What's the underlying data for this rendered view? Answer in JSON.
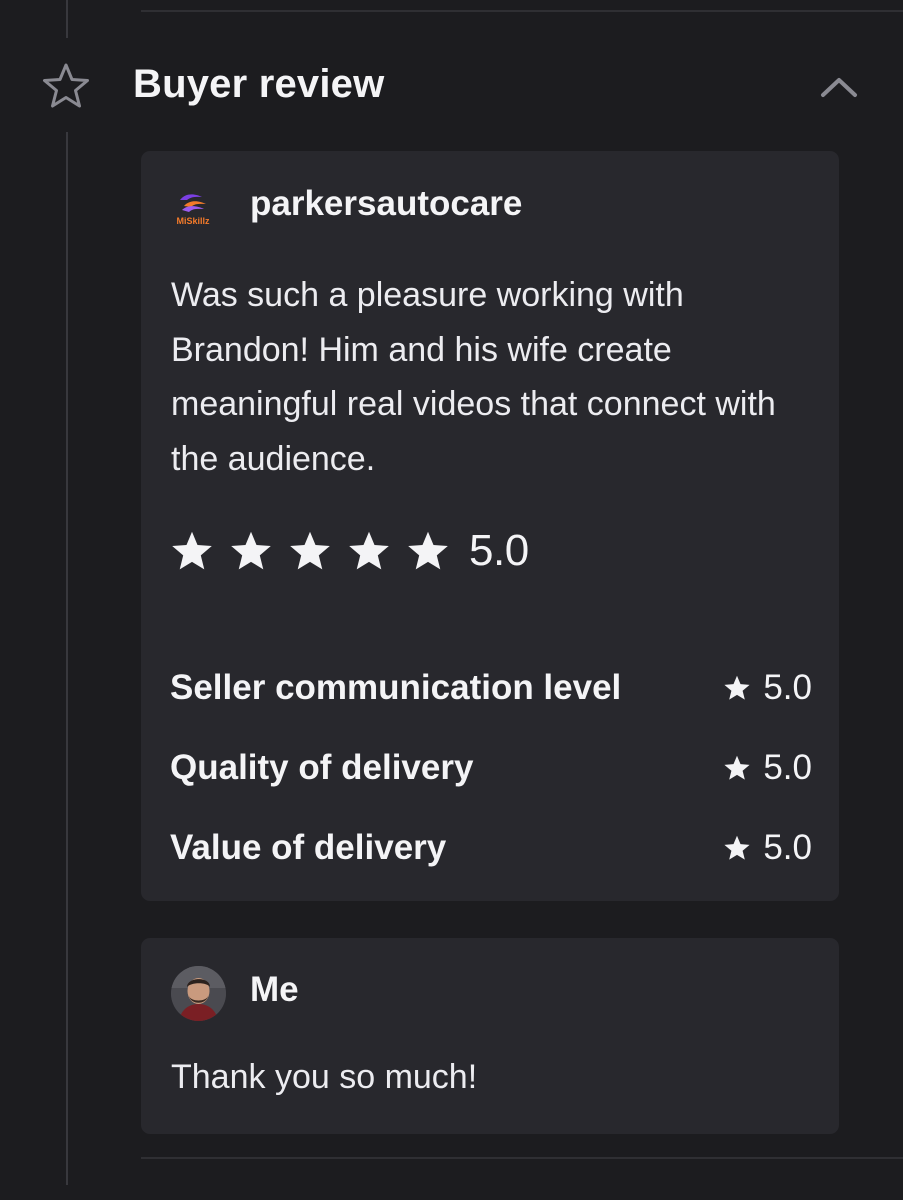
{
  "section": {
    "title": "Buyer review",
    "icon": "star-outline-icon",
    "toggle_icon": "chevron-up-icon"
  },
  "review": {
    "buyer_name": "parkersautocare",
    "buyer_logo_text": "MiSkillz",
    "text": "Was such a pleasure working with Brandon! Him and his wife create meaningful real videos that connect with the audience.",
    "stars": 5,
    "overall_rating": "5.0",
    "metrics": [
      {
        "label": "Seller communication level",
        "value": "5.0"
      },
      {
        "label": "Quality of delivery",
        "value": "5.0"
      },
      {
        "label": "Value of delivery",
        "value": "5.0"
      }
    ]
  },
  "reply": {
    "author": "Me",
    "text": "Thank you so much!"
  },
  "colors": {
    "background": "#1c1c1f",
    "card": "#28282d",
    "text": "#f4f4f6",
    "muted_icon": "#8a8a92",
    "logo_purple": "#7b3fe4",
    "logo_orange": "#f27a2a"
  }
}
